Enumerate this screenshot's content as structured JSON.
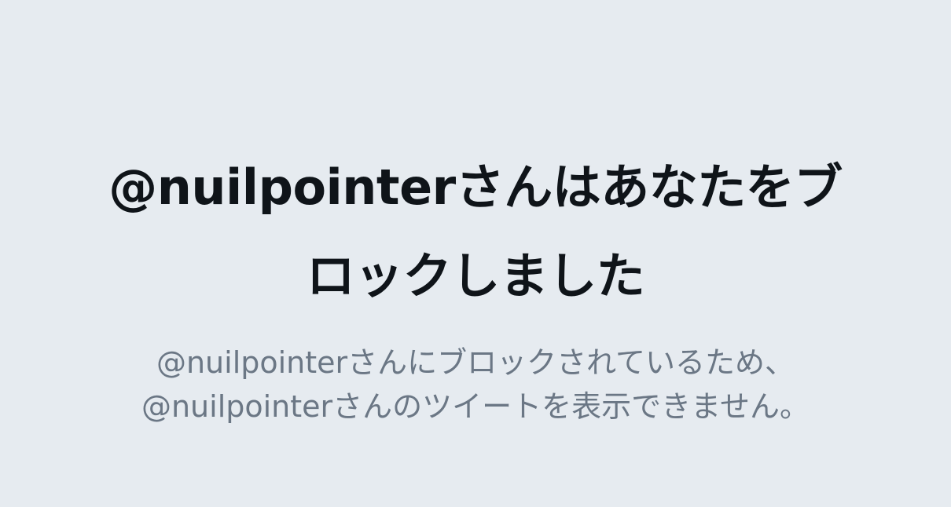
{
  "blocked_notice": {
    "title_line1": "@nuilpointerさんはあなたをブ",
    "title_line2": "ロックしました",
    "message_line1": "@nuilpointerさんにブロックされているため、",
    "message_line2": "@nuilpointerさんのツイートを表示できません。"
  },
  "colors": {
    "background": "#e6ebf0",
    "title": "#0f1419",
    "message": "#6b7785"
  }
}
